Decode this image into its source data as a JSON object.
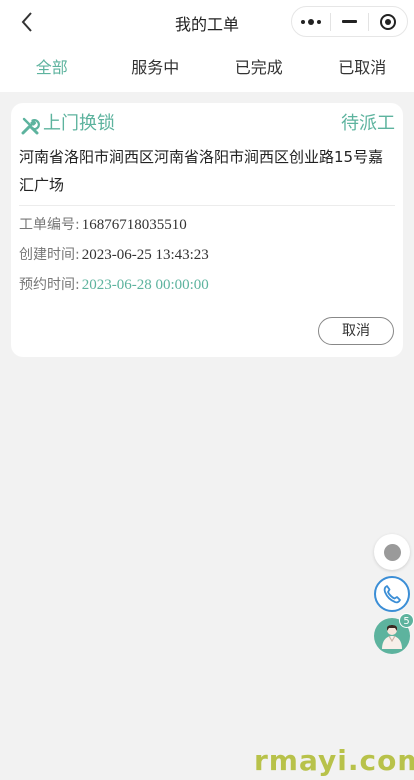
{
  "header": {
    "title": "我的工单",
    "back_icon": "chevron-left-icon",
    "capsule_icons": [
      "more-dots-icon",
      "minimize-icon",
      "target-icon"
    ]
  },
  "tabs": [
    {
      "label": "全部",
      "active": true
    },
    {
      "label": "服务中",
      "active": false
    },
    {
      "label": "已完成",
      "active": false
    },
    {
      "label": "已取消",
      "active": false
    }
  ],
  "order": {
    "service_icon": "wrench-icon",
    "service_type": "上门换锁",
    "status": "待派工",
    "address": "河南省洛阳市涧西区河南省洛阳市涧西区创业路15号嘉汇广场",
    "fields": [
      {
        "label": "工单编号:",
        "value": "16876718035510"
      },
      {
        "label": "创建时间:",
        "value": "2023-06-25 13:43:23"
      },
      {
        "label": "预约时间:",
        "value": "2023-06-28 00:00:00"
      }
    ],
    "cancel_label": "取消"
  },
  "floating": {
    "record_icon": "record-dot-icon",
    "phone_icon": "phone-icon",
    "avatar_icon": "service-avatar-icon",
    "badge_count": "5"
  },
  "watermark": "rmayi.com",
  "colors": {
    "accent": "#5db39e",
    "phone_blue": "#3b8ed6",
    "background": "#f2f2f2"
  }
}
